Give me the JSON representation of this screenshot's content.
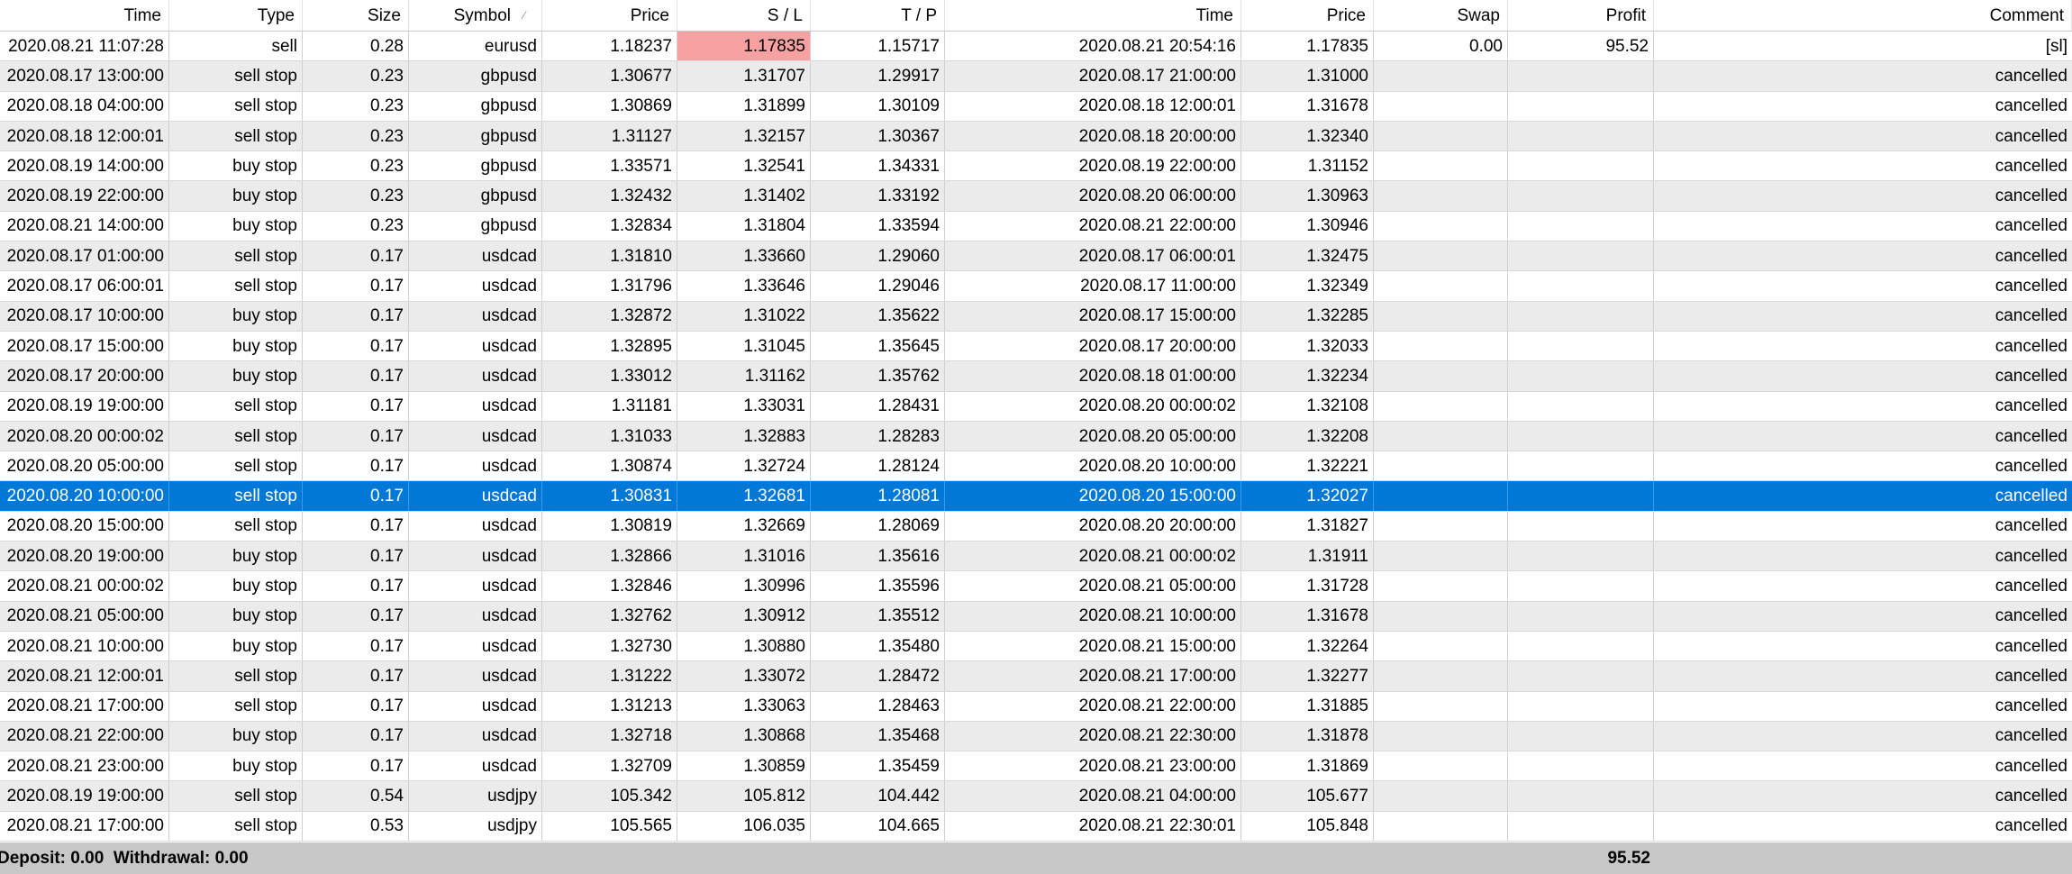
{
  "columns": {
    "time": "Time",
    "type": "Type",
    "size": "Size",
    "symbol": "Symbol",
    "price": "Price",
    "sl": "S / L",
    "tp": "T / P",
    "close_time": "Time",
    "close_price": "Price",
    "swap": "Swap",
    "profit": "Profit",
    "comment": "Comment"
  },
  "sort_indicator": "⁄",
  "selected_row_index": 15,
  "sl_hit_row_index": 0,
  "colors": {
    "selection": "#0078d7",
    "sl_highlight": "#f7a1a3",
    "summary_bar": "#c8c8c8",
    "alt_row": "#ebebeb"
  },
  "rows": [
    {
      "time": "2020.08.21 11:07:28",
      "type": "sell",
      "size": "0.28",
      "symbol": "eurusd",
      "price": "1.18237",
      "sl": "1.17835",
      "tp": "1.15717",
      "close_time": "2020.08.21 20:54:16",
      "close_price": "1.17835",
      "swap": "0.00",
      "profit": "95.52",
      "comment": "[sl]"
    },
    {
      "time": "2020.08.17 13:00:00",
      "type": "sell stop",
      "size": "0.23",
      "symbol": "gbpusd",
      "price": "1.30677",
      "sl": "1.31707",
      "tp": "1.29917",
      "close_time": "2020.08.17 21:00:00",
      "close_price": "1.31000",
      "swap": "",
      "profit": "",
      "comment": "cancelled"
    },
    {
      "time": "2020.08.18 04:00:00",
      "type": "sell stop",
      "size": "0.23",
      "symbol": "gbpusd",
      "price": "1.30869",
      "sl": "1.31899",
      "tp": "1.30109",
      "close_time": "2020.08.18 12:00:01",
      "close_price": "1.31678",
      "swap": "",
      "profit": "",
      "comment": "cancelled"
    },
    {
      "time": "2020.08.18 12:00:01",
      "type": "sell stop",
      "size": "0.23",
      "symbol": "gbpusd",
      "price": "1.31127",
      "sl": "1.32157",
      "tp": "1.30367",
      "close_time": "2020.08.18 20:00:00",
      "close_price": "1.32340",
      "swap": "",
      "profit": "",
      "comment": "cancelled"
    },
    {
      "time": "2020.08.19 14:00:00",
      "type": "buy stop",
      "size": "0.23",
      "symbol": "gbpusd",
      "price": "1.33571",
      "sl": "1.32541",
      "tp": "1.34331",
      "close_time": "2020.08.19 22:00:00",
      "close_price": "1.31152",
      "swap": "",
      "profit": "",
      "comment": "cancelled"
    },
    {
      "time": "2020.08.19 22:00:00",
      "type": "buy stop",
      "size": "0.23",
      "symbol": "gbpusd",
      "price": "1.32432",
      "sl": "1.31402",
      "tp": "1.33192",
      "close_time": "2020.08.20 06:00:00",
      "close_price": "1.30963",
      "swap": "",
      "profit": "",
      "comment": "cancelled"
    },
    {
      "time": "2020.08.21 14:00:00",
      "type": "buy stop",
      "size": "0.23",
      "symbol": "gbpusd",
      "price": "1.32834",
      "sl": "1.31804",
      "tp": "1.33594",
      "close_time": "2020.08.21 22:00:00",
      "close_price": "1.30946",
      "swap": "",
      "profit": "",
      "comment": "cancelled"
    },
    {
      "time": "2020.08.17 01:00:00",
      "type": "sell stop",
      "size": "0.17",
      "symbol": "usdcad",
      "price": "1.31810",
      "sl": "1.33660",
      "tp": "1.29060",
      "close_time": "2020.08.17 06:00:01",
      "close_price": "1.32475",
      "swap": "",
      "profit": "",
      "comment": "cancelled"
    },
    {
      "time": "2020.08.17 06:00:01",
      "type": "sell stop",
      "size": "0.17",
      "symbol": "usdcad",
      "price": "1.31796",
      "sl": "1.33646",
      "tp": "1.29046",
      "close_time": "2020.08.17 11:00:00",
      "close_price": "1.32349",
      "swap": "",
      "profit": "",
      "comment": "cancelled"
    },
    {
      "time": "2020.08.17 10:00:00",
      "type": "buy stop",
      "size": "0.17",
      "symbol": "usdcad",
      "price": "1.32872",
      "sl": "1.31022",
      "tp": "1.35622",
      "close_time": "2020.08.17 15:00:00",
      "close_price": "1.32285",
      "swap": "",
      "profit": "",
      "comment": "cancelled"
    },
    {
      "time": "2020.08.17 15:00:00",
      "type": "buy stop",
      "size": "0.17",
      "symbol": "usdcad",
      "price": "1.32895",
      "sl": "1.31045",
      "tp": "1.35645",
      "close_time": "2020.08.17 20:00:00",
      "close_price": "1.32033",
      "swap": "",
      "profit": "",
      "comment": "cancelled"
    },
    {
      "time": "2020.08.17 20:00:00",
      "type": "buy stop",
      "size": "0.17",
      "symbol": "usdcad",
      "price": "1.33012",
      "sl": "1.31162",
      "tp": "1.35762",
      "close_time": "2020.08.18 01:00:00",
      "close_price": "1.32234",
      "swap": "",
      "profit": "",
      "comment": "cancelled"
    },
    {
      "time": "2020.08.19 19:00:00",
      "type": "sell stop",
      "size": "0.17",
      "symbol": "usdcad",
      "price": "1.31181",
      "sl": "1.33031",
      "tp": "1.28431",
      "close_time": "2020.08.20 00:00:02",
      "close_price": "1.32108",
      "swap": "",
      "profit": "",
      "comment": "cancelled"
    },
    {
      "time": "2020.08.20 00:00:02",
      "type": "sell stop",
      "size": "0.17",
      "symbol": "usdcad",
      "price": "1.31033",
      "sl": "1.32883",
      "tp": "1.28283",
      "close_time": "2020.08.20 05:00:00",
      "close_price": "1.32208",
      "swap": "",
      "profit": "",
      "comment": "cancelled"
    },
    {
      "time": "2020.08.20 05:00:00",
      "type": "sell stop",
      "size": "0.17",
      "symbol": "usdcad",
      "price": "1.30874",
      "sl": "1.32724",
      "tp": "1.28124",
      "close_time": "2020.08.20 10:00:00",
      "close_price": "1.32221",
      "swap": "",
      "profit": "",
      "comment": "cancelled"
    },
    {
      "time": "2020.08.20 10:00:00",
      "type": "sell stop",
      "size": "0.17",
      "symbol": "usdcad",
      "price": "1.30831",
      "sl": "1.32681",
      "tp": "1.28081",
      "close_time": "2020.08.20 15:00:00",
      "close_price": "1.32027",
      "swap": "",
      "profit": "",
      "comment": "cancelled"
    },
    {
      "time": "2020.08.20 15:00:00",
      "type": "sell stop",
      "size": "0.17",
      "symbol": "usdcad",
      "price": "1.30819",
      "sl": "1.32669",
      "tp": "1.28069",
      "close_time": "2020.08.20 20:00:00",
      "close_price": "1.31827",
      "swap": "",
      "profit": "",
      "comment": "cancelled"
    },
    {
      "time": "2020.08.20 19:00:00",
      "type": "buy stop",
      "size": "0.17",
      "symbol": "usdcad",
      "price": "1.32866",
      "sl": "1.31016",
      "tp": "1.35616",
      "close_time": "2020.08.21 00:00:02",
      "close_price": "1.31911",
      "swap": "",
      "profit": "",
      "comment": "cancelled"
    },
    {
      "time": "2020.08.21 00:00:02",
      "type": "buy stop",
      "size": "0.17",
      "symbol": "usdcad",
      "price": "1.32846",
      "sl": "1.30996",
      "tp": "1.35596",
      "close_time": "2020.08.21 05:00:00",
      "close_price": "1.31728",
      "swap": "",
      "profit": "",
      "comment": "cancelled"
    },
    {
      "time": "2020.08.21 05:00:00",
      "type": "buy stop",
      "size": "0.17",
      "symbol": "usdcad",
      "price": "1.32762",
      "sl": "1.30912",
      "tp": "1.35512",
      "close_time": "2020.08.21 10:00:00",
      "close_price": "1.31678",
      "swap": "",
      "profit": "",
      "comment": "cancelled"
    },
    {
      "time": "2020.08.21 10:00:00",
      "type": "buy stop",
      "size": "0.17",
      "symbol": "usdcad",
      "price": "1.32730",
      "sl": "1.30880",
      "tp": "1.35480",
      "close_time": "2020.08.21 15:00:00",
      "close_price": "1.32264",
      "swap": "",
      "profit": "",
      "comment": "cancelled"
    },
    {
      "time": "2020.08.21 12:00:01",
      "type": "sell stop",
      "size": "0.17",
      "symbol": "usdcad",
      "price": "1.31222",
      "sl": "1.33072",
      "tp": "1.28472",
      "close_time": "2020.08.21 17:00:00",
      "close_price": "1.32277",
      "swap": "",
      "profit": "",
      "comment": "cancelled"
    },
    {
      "time": "2020.08.21 17:00:00",
      "type": "sell stop",
      "size": "0.17",
      "symbol": "usdcad",
      "price": "1.31213",
      "sl": "1.33063",
      "tp": "1.28463",
      "close_time": "2020.08.21 22:00:00",
      "close_price": "1.31885",
      "swap": "",
      "profit": "",
      "comment": "cancelled"
    },
    {
      "time": "2020.08.21 22:00:00",
      "type": "buy stop",
      "size": "0.17",
      "symbol": "usdcad",
      "price": "1.32718",
      "sl": "1.30868",
      "tp": "1.35468",
      "close_time": "2020.08.21 22:30:00",
      "close_price": "1.31878",
      "swap": "",
      "profit": "",
      "comment": "cancelled"
    },
    {
      "time": "2020.08.21 23:00:00",
      "type": "buy stop",
      "size": "0.17",
      "symbol": "usdcad",
      "price": "1.32709",
      "sl": "1.30859",
      "tp": "1.35459",
      "close_time": "2020.08.21 23:00:00",
      "close_price": "1.31869",
      "swap": "",
      "profit": "",
      "comment": "cancelled"
    },
    {
      "time": "2020.08.19 19:00:00",
      "type": "sell stop",
      "size": "0.54",
      "symbol": "usdjpy",
      "price": "105.342",
      "sl": "105.812",
      "tp": "104.442",
      "close_time": "2020.08.21 04:00:00",
      "close_price": "105.677",
      "swap": "",
      "profit": "",
      "comment": "cancelled"
    },
    {
      "time": "2020.08.21 17:00:00",
      "type": "sell stop",
      "size": "0.53",
      "symbol": "usdjpy",
      "price": "105.565",
      "sl": "106.035",
      "tp": "104.665",
      "close_time": "2020.08.21 22:30:01",
      "close_price": "105.848",
      "swap": "",
      "profit": "",
      "comment": "cancelled"
    }
  ],
  "summary": {
    "text": "Deposit: 0.00  Withdrawal: 0.00",
    "profit_total": "95.52"
  }
}
